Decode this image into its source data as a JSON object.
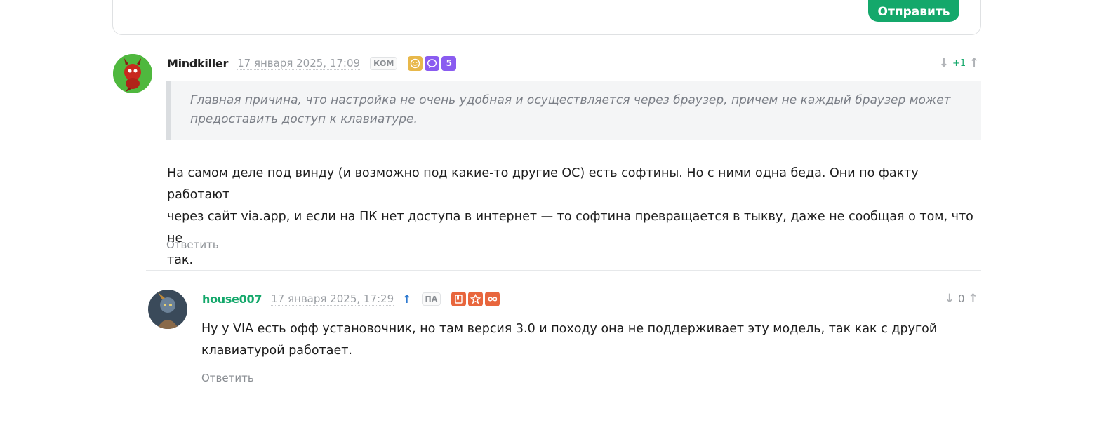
{
  "form": {
    "send_label": "Отправить"
  },
  "comments": [
    {
      "username": "Mindkiller",
      "timestamp": "17 января 2025, 17:09",
      "role_badge": "КОМ",
      "badges": [
        {
          "icon": "smile-icon",
          "color": "#e8b84a",
          "text": "☺"
        },
        {
          "icon": "speech-bubble-icon",
          "color": "#8a5cf0",
          "text": "◯"
        },
        {
          "icon": "count-badge",
          "color": "#8a5cf0",
          "text": "5"
        }
      ],
      "score": "+1",
      "quote": "Главная причина, что настройка не очень удобная и осуществляется через браузер, причем не каждый браузер может предоставить доступ к клавиатуре.",
      "body_lines": [
        "На самом деле под винду (и возможно под какие-то другие ОС) есть софтины. Но с ними одна беда. Они по факту работают",
        "через сайт via.app, и если на ПК нет доступа в интернет — то софтина превращается в тыкву, даже не сообщая о том, что не",
        "так."
      ],
      "reply_label": "Ответить"
    },
    {
      "username": "house007",
      "timestamp": "17 января 2025, 17:29",
      "parent_link": "↑",
      "role_badge": "ПА",
      "badges": [
        {
          "icon": "book-icon",
          "color": "#e8663d",
          "text": "▮"
        },
        {
          "icon": "star-icon",
          "color": "#e8663d",
          "text": "☆"
        },
        {
          "icon": "infinity-icon",
          "color": "#e8663d",
          "text": "∞"
        }
      ],
      "score": "0",
      "body_lines": [
        "Ну у VIA есть офф установочник, но там версия 3.0 и походу она не поддерживает эту модель, так как с другой",
        "клавиатурой работает."
      ],
      "reply_label": "Ответить"
    }
  ],
  "vote_icons": {
    "down": "↓",
    "up": "↑"
  }
}
